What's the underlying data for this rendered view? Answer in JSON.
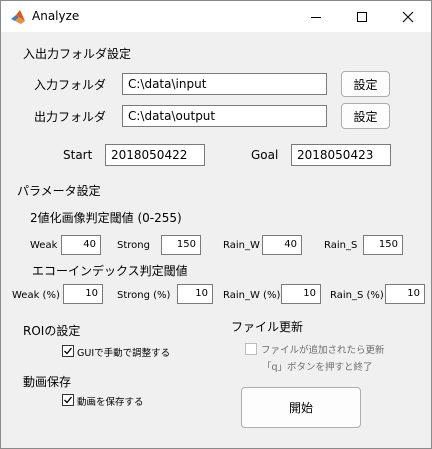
{
  "window": {
    "title": "Analyze"
  },
  "folder_settings": {
    "heading": "入出力フォルダ設定",
    "input_label": "入力フォルダ",
    "input_value": "C:\\data\\input",
    "input_button": "設定",
    "output_label": "出力フォルダ",
    "output_value": "C:\\data\\output",
    "output_button": "設定",
    "start_label": "Start",
    "start_value": "2018050422",
    "goal_label": "Goal",
    "goal_value": "2018050423"
  },
  "params": {
    "heading": "パラメータ設定",
    "binarize_heading": "2値化画像判定閾値 (0-255)",
    "binarize": [
      {
        "label": "Weak",
        "value": "40"
      },
      {
        "label": "Strong",
        "value": "150"
      },
      {
        "label": "Rain_W",
        "value": "40"
      },
      {
        "label": "Rain_S",
        "value": "150"
      }
    ],
    "echo_heading": "エコーインデックス判定閾値",
    "echo": [
      {
        "label": "Weak (%)",
        "value": "10"
      },
      {
        "label": "Strong (%)",
        "value": "10"
      },
      {
        "label": "Rain_W (%)",
        "value": "10"
      },
      {
        "label": "Rain_S (%)",
        "value": "10"
      }
    ]
  },
  "roi": {
    "heading": "ROIの設定",
    "checkbox_label": "GUIで手動で調整する",
    "checked": true
  },
  "video": {
    "heading": "動画保存",
    "checkbox_label": "動画を保存する",
    "checked": true
  },
  "file_update": {
    "heading": "ファイル更新",
    "checkbox_label": "ファイルが追加されたら更新",
    "checked": false,
    "note": "「q」ボタンを押すと終了"
  },
  "start_button": "開始",
  "icons": {
    "app": "matlab-icon",
    "minimize": "minimize-icon",
    "maximize": "maximize-icon",
    "close": "close-icon",
    "check": "checkmark-icon"
  },
  "colors": {
    "window_bg": "#f0f0f0",
    "titlebar_bg": "#ffffff",
    "field_border": "#7a7a7a",
    "button_border": "#adadad"
  }
}
